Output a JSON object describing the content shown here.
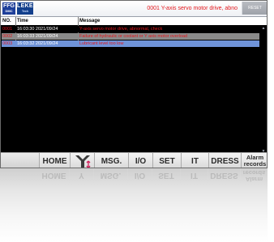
{
  "title_bar": {
    "logo_primary": [
      "FFG",
      "DMC"
    ],
    "logo_secondary": [
      "LEKEL",
      "Tech"
    ],
    "current_alarm": "0001  Y-axis servo motor drive, abno",
    "reset_label": "RESET"
  },
  "alarm_table": {
    "columns": [
      "NO.",
      "Time",
      "Message"
    ],
    "rows": [
      {
        "no": "0001",
        "time": "16:03:30 2021/09/24",
        "message": "Y-axis servo motor drive, abnormal, check"
      },
      {
        "no": "0002",
        "time": "16:03:33 2021/09/24",
        "message": "Failure of hydraulic or coolant or Y axis motor overload"
      },
      {
        "no": "0003",
        "time": "16:03:32 2021/09/24",
        "message": "Lubricant level too low"
      }
    ],
    "colors": {
      "alarm_text": "#e4171c",
      "selected_row": "#6f93d8",
      "second_row": "#8a8a8a"
    }
  },
  "toolbar": {
    "buttons": [
      {
        "label": ""
      },
      {
        "label": "HOME"
      },
      {
        "label": "Y",
        "icon": "axis-y-icon"
      },
      {
        "label": "MSG."
      },
      {
        "label": "I/O"
      },
      {
        "label": "SET"
      },
      {
        "label": "IT"
      },
      {
        "label": "DRESS"
      },
      {
        "label_lines": [
          "Alarm",
          "records"
        ]
      }
    ]
  }
}
